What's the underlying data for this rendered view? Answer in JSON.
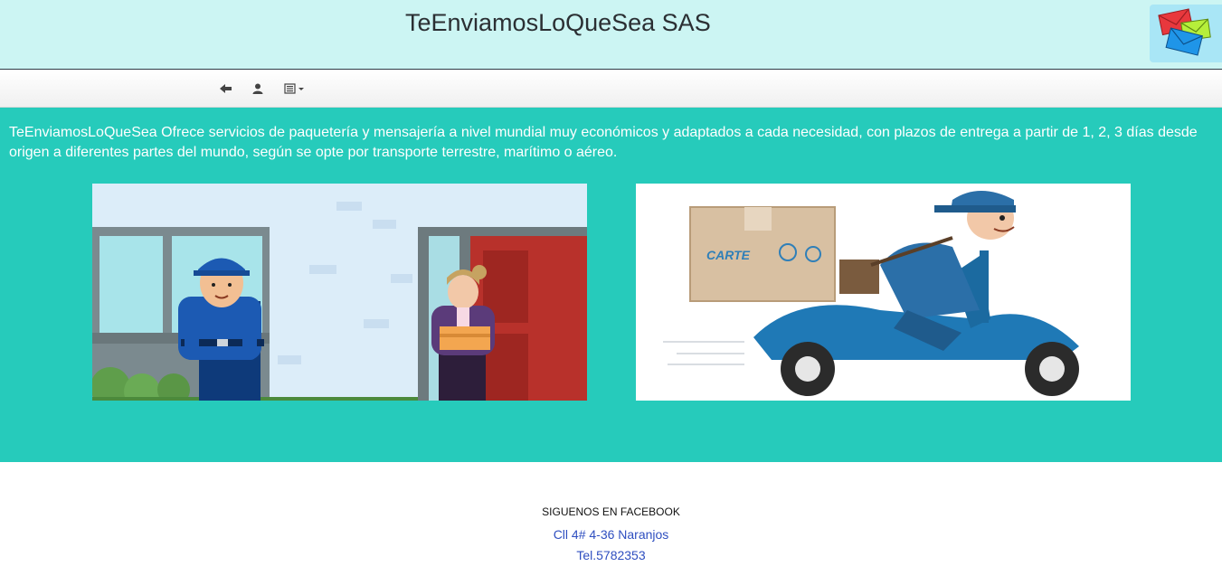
{
  "header": {
    "title": "TeEnviamosLoQueSea SAS",
    "logo_icon": "envelopes-icon"
  },
  "navbar": {
    "icons": [
      "back-arrow-icon",
      "user-icon",
      "list-dropdown-icon"
    ]
  },
  "main": {
    "intro_text": "TeEnviamosLoQueSea Ofrece servicios de paquetería y mensajería a nivel mundial muy económicos y adaptados a cada necesidad, con plazos de entrega a partir de 1, 2, 3 días desde origen a diferentes partes del mundo, según se opte por transporte terrestre, marítimo o aéreo.",
    "illustration_2_box_text": "CARTE"
  },
  "footer": {
    "follow": "SIGUENOS EN FACEBOOK",
    "address": "Cll 4# 4-36 Naranjos",
    "phone": "Tel.5782353"
  },
  "colors": {
    "header_bg": "#ccf5f3",
    "main_bg": "#26cbbb",
    "link": "#2f4fc0"
  }
}
